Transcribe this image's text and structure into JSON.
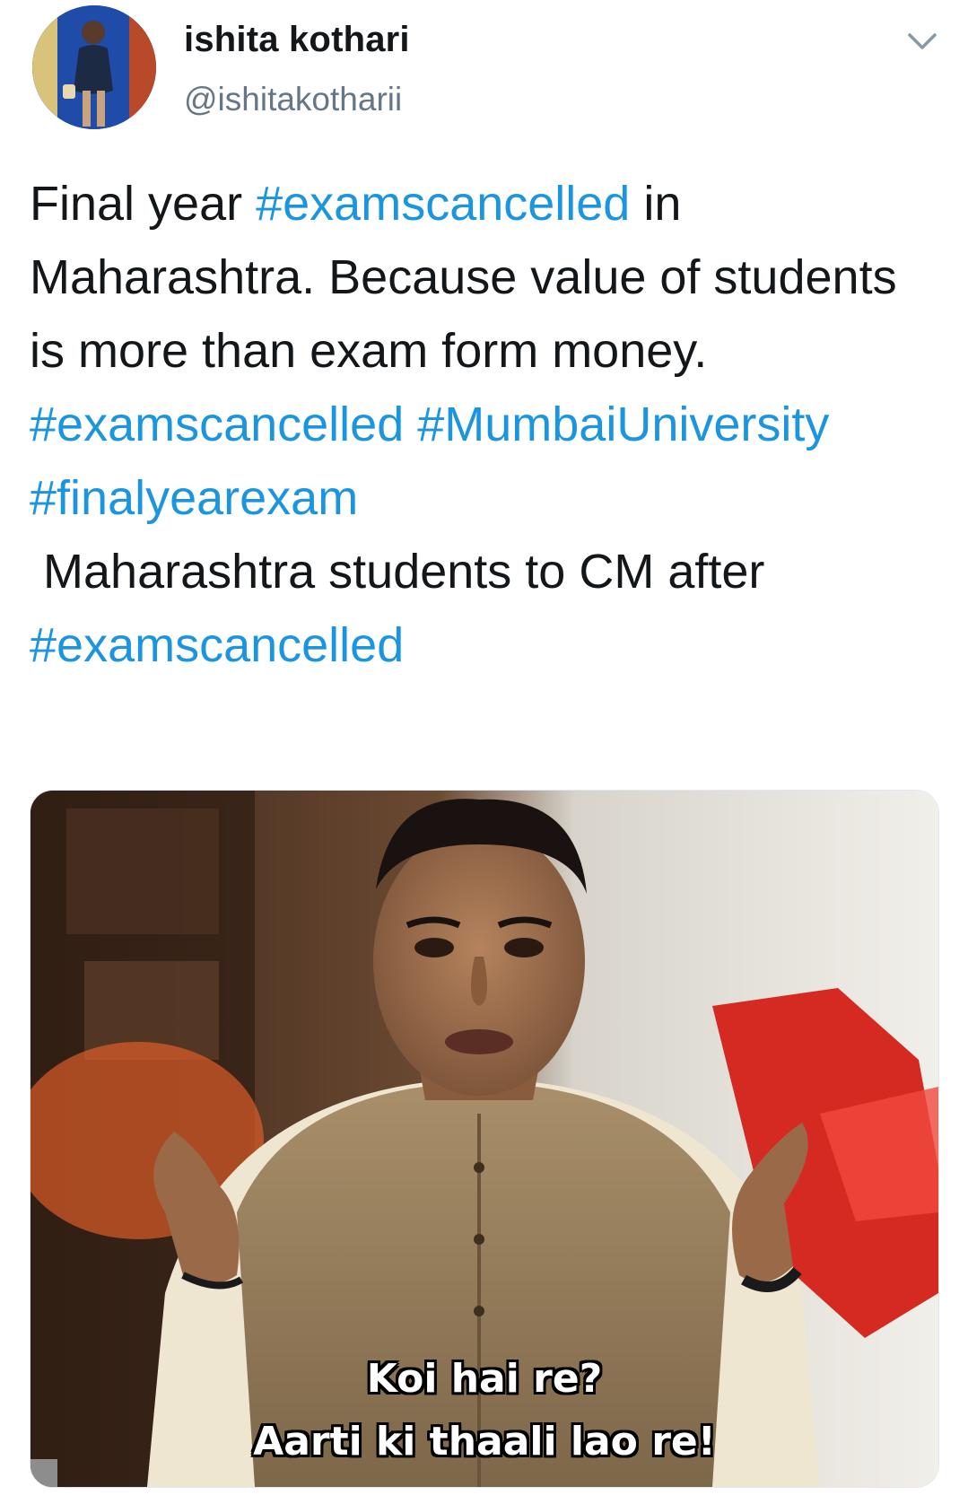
{
  "author": {
    "name": "ishita kothari",
    "handle": "@ishitakotharii"
  },
  "icons": {
    "menu": "chevron-down-icon",
    "avatar": "profile-photo"
  },
  "colors": {
    "hashtag": "#1b95e0",
    "text": "#14171a",
    "secondary": "#657786"
  },
  "tweet": {
    "segments": [
      {
        "type": "text",
        "value": "Final year "
      },
      {
        "type": "hashtag",
        "value": "#examscancelled"
      },
      {
        "type": "text",
        "value": " in Maharashtra. Because value of students is more than exam form money.  "
      },
      {
        "type": "hashtag",
        "value": "#examscancelled"
      },
      {
        "type": "text",
        "value": " "
      },
      {
        "type": "hashtag",
        "value": "#MumbaiUniversity"
      },
      {
        "type": "text",
        "value": "\n"
      },
      {
        "type": "hashtag",
        "value": "#finalyearexam"
      },
      {
        "type": "text",
        "value": "\n Maharashtra students to CM after "
      },
      {
        "type": "hashtag",
        "value": "#examscancelled"
      }
    ]
  },
  "media": {
    "caption_line_1": "Koi hai re?",
    "caption_line_2": "Aarti ki thaali lao re!"
  }
}
